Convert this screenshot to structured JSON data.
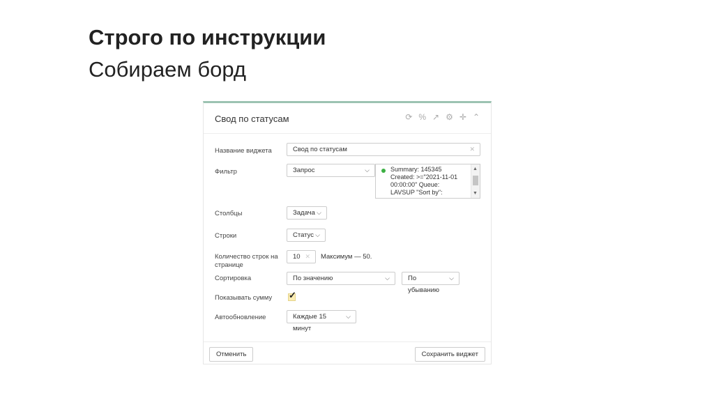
{
  "slide": {
    "title": "Строго по инструкции",
    "subtitle": "Собираем борд"
  },
  "widget": {
    "title": "Свод по статусам",
    "header_icons": [
      "refresh-icon",
      "link-icon",
      "external-link-icon",
      "gear-icon",
      "move-icon",
      "collapse-icon"
    ],
    "fields": {
      "name": {
        "label": "Название виджета",
        "value": "Свод по статусам"
      },
      "filter": {
        "label": "Фильтр",
        "type_value": "Запрос",
        "query_lines": [
          "Summary: 145345",
          "Created: >=\"2021-11-01",
          "00:00:00\" Queue:",
          "LAVSUP \"Sort by\":"
        ],
        "status_color": "#3cb043"
      },
      "columns": {
        "label": "Столбцы",
        "value": "Задача"
      },
      "rows": {
        "label": "Строки",
        "value": "Статус"
      },
      "per_page": {
        "label": "Количество строк на странице",
        "value": "10",
        "hint": "Максимум — 50."
      },
      "sort": {
        "label": "Сортировка",
        "value": "По значению",
        "order": "По убыванию"
      },
      "show_sum": {
        "label": "Показывать сумму",
        "checked": true
      },
      "autorefresh": {
        "label": "Автообновление",
        "value": "Каждые 15 минут"
      }
    },
    "cancel_label": "Отменить",
    "save_label": "Сохранить виджет"
  }
}
